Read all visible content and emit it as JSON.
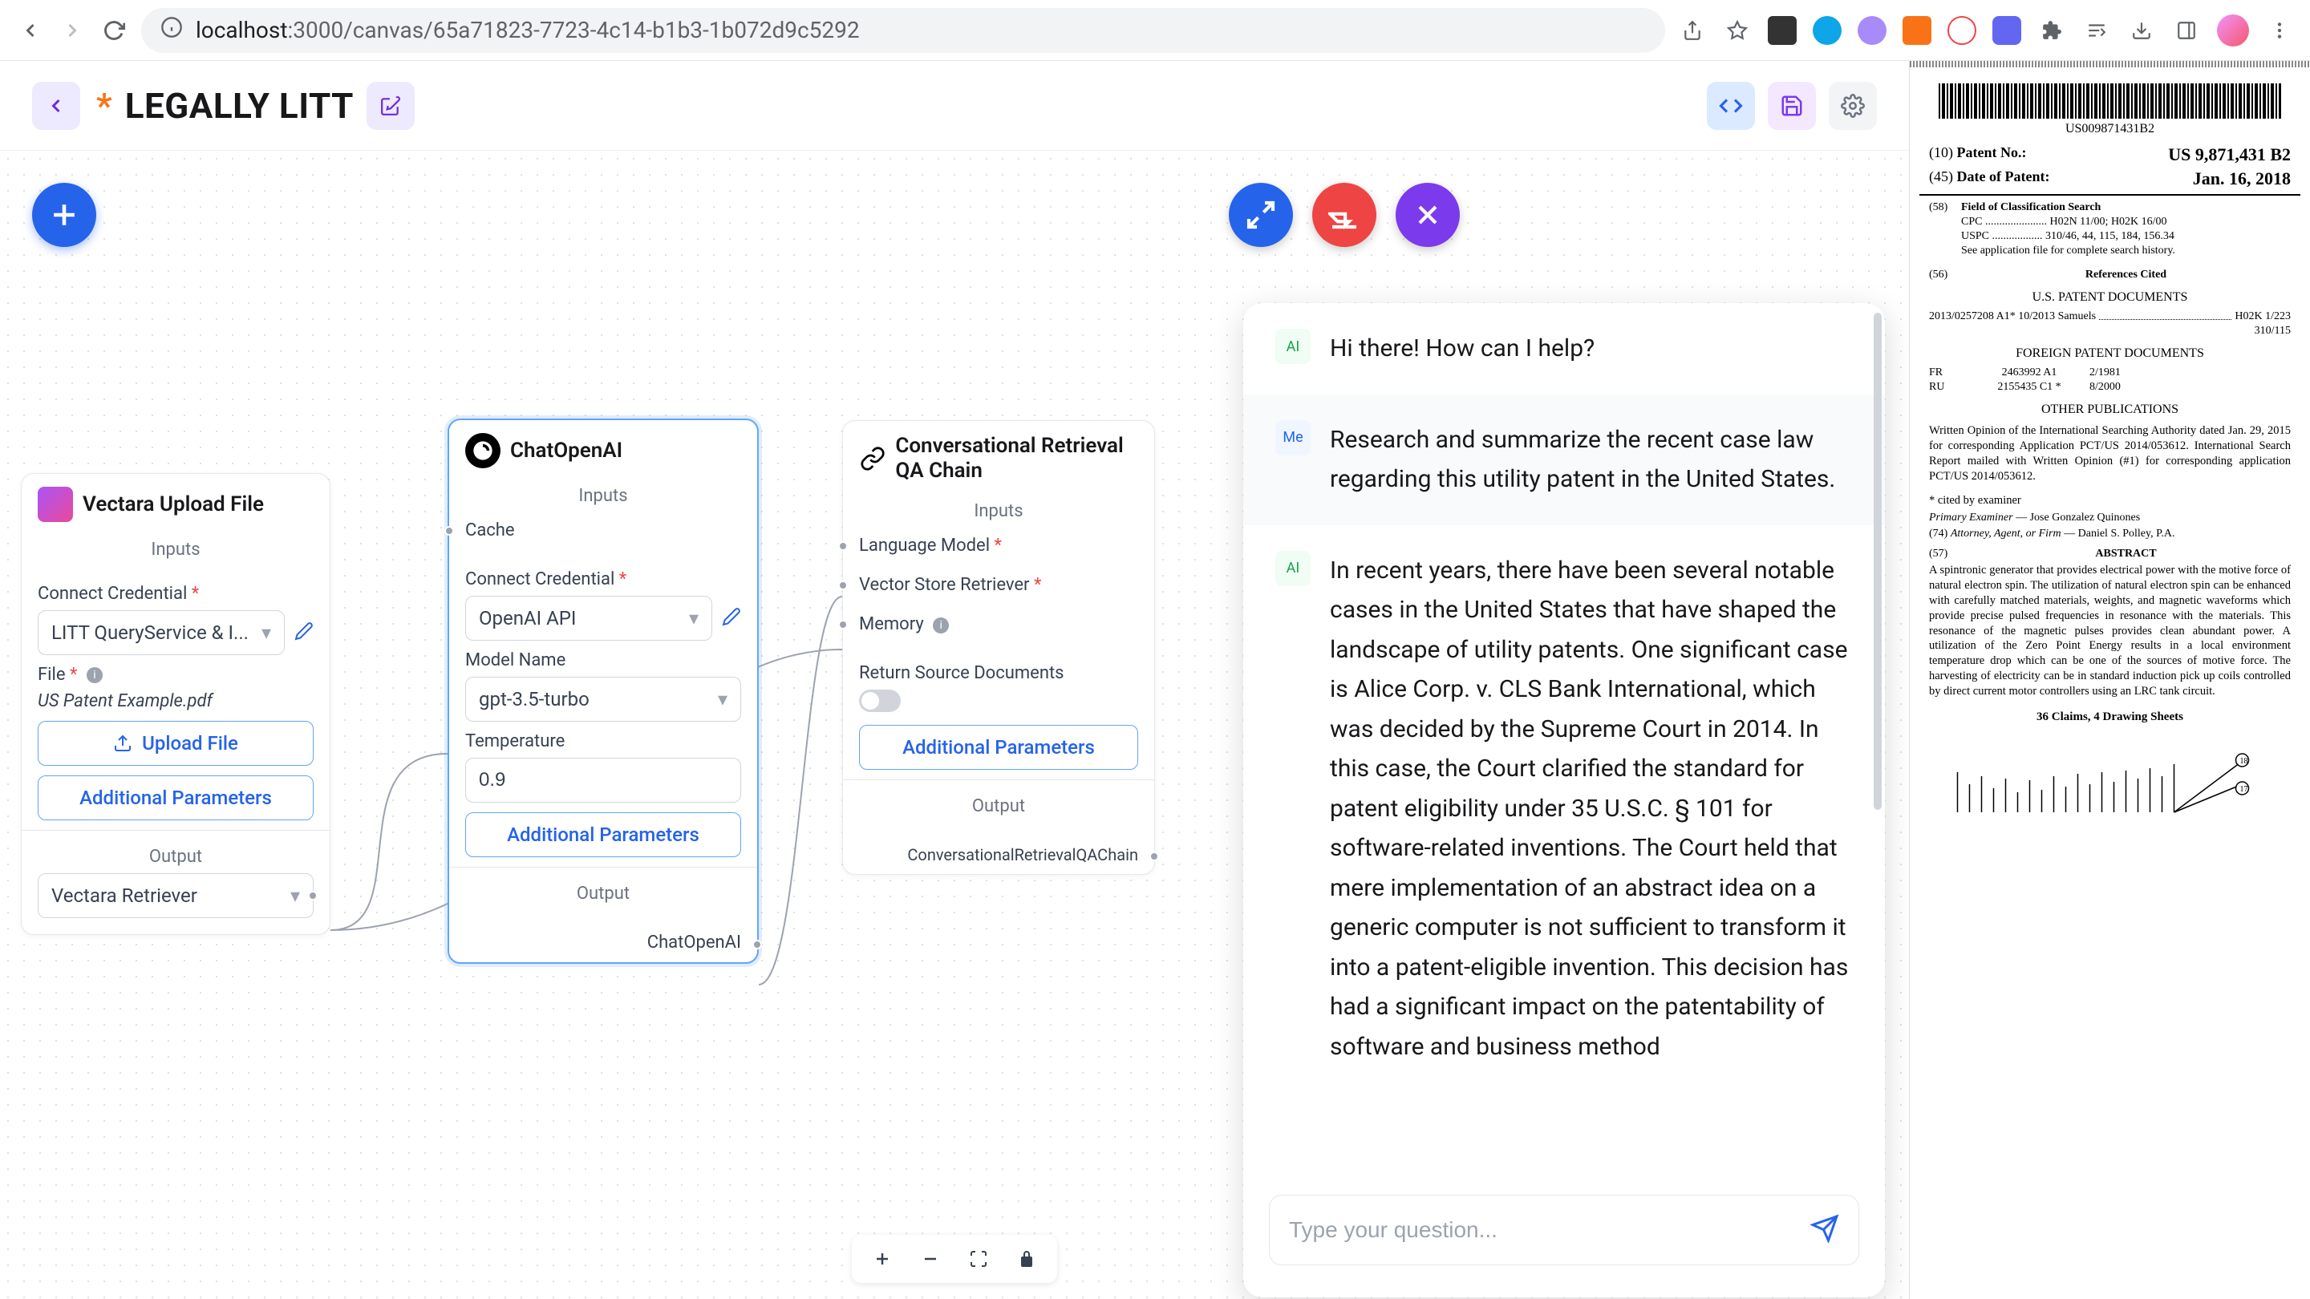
{
  "browser": {
    "url_host": "localhost",
    "url_port": ":3000",
    "url_path": "/canvas/65a71823-7723-4c14-b1b3-1b072d9c5292"
  },
  "header": {
    "asterisk": "*",
    "title": "LEGALLY LITT"
  },
  "nodes": {
    "vectara": {
      "title": "Vectara Upload File",
      "inputs_label": "Inputs",
      "connect_credential_label": "Connect Credential",
      "credential_value": "LITT QueryService & I...",
      "file_label": "File",
      "file_name": "US Patent Example.pdf",
      "upload_btn": "Upload File",
      "additional_params_btn": "Additional Parameters",
      "output_label": "Output",
      "output_select": "Vectara Retriever"
    },
    "chatopenai": {
      "title": "ChatOpenAI",
      "inputs_label": "Inputs",
      "cache_port": "Cache",
      "connect_credential_label": "Connect Credential",
      "credential_value": "OpenAI API",
      "model_name_label": "Model Name",
      "model_value": "gpt-3.5-turbo",
      "temperature_label": "Temperature",
      "temperature_value": "0.9",
      "additional_params_btn": "Additional Parameters",
      "output_label": "Output",
      "output_name": "ChatOpenAI"
    },
    "convqa": {
      "title": "Conversational Retrieval QA Chain",
      "inputs_label": "Inputs",
      "language_model_port": "Language Model",
      "vector_store_port": "Vector Store Retriever",
      "memory_port": "Memory",
      "return_source_label": "Return Source Documents",
      "additional_params_btn": "Additional Parameters",
      "output_label": "Output",
      "output_name": "ConversationalRetrievalQAChain"
    }
  },
  "chat": {
    "greeting": "Hi there! How can I help?",
    "user_query": "Research and summarize the recent case law regarding this utility patent in the United States.",
    "ai_response": "In recent years, there have been several notable cases in the United States that have shaped the landscape of utility patents. One significant case is Alice Corp. v. CLS Bank International, which was decided by the Supreme Court in 2014. In this case, the Court clarified the standard for patent eligibility under 35 U.S.C. § 101 for software-related inventions. The Court held that mere implementation of an abstract idea on a generic computer is not sufficient to transform it into a patent-eligible invention. This decision has had a significant impact on the patentability of software and business method",
    "ai_label": "AI",
    "me_label": "Me",
    "input_placeholder": "Type your question..."
  },
  "patent": {
    "barcode_text": "US009871431B2",
    "patent_no_label": "Patent No.:",
    "patent_no_prefix": "(10)",
    "patent_no": "US 9,871,431 B2",
    "date_label": "Date of Patent:",
    "date_prefix": "(45)",
    "date": "Jan. 16, 2018",
    "field_58": "(58)",
    "field_search_title": "Field of Classification Search",
    "cpc_line": "CPC ...................... H02N 11/00; H02K 16/00",
    "uspc_line": "USPC .................. 310/46, 44, 115, 184, 156.34",
    "search_history": "See application file for complete search history.",
    "field_56": "(56)",
    "refs_cited": "References Cited",
    "us_patent_docs": "U.S. PATENT DOCUMENTS",
    "us_ref_1": "2013/0257208 A1* 10/2013 Samuels",
    "us_ref_1_class": "H02K 1/223",
    "us_ref_1_sub": "310/115",
    "foreign_docs": "FOREIGN PATENT DOCUMENTS",
    "foreign_1_cc": "FR",
    "foreign_1_num": "2463992 A1",
    "foreign_1_date": "2/1981",
    "foreign_2_cc": "RU",
    "foreign_2_num": "2155435 C1 *",
    "foreign_2_date": "8/2000",
    "other_pubs": "OTHER PUBLICATIONS",
    "other_pub_text": "Written Opinion of the International Searching Authority dated Jan. 29, 2015 for corresponding Application PCT/US 2014/053612. International Search Report mailed with Written Opinion (#1) for corresponding application PCT/US 2014/053612.",
    "cited_by": "* cited by examiner",
    "primary_examiner_label": "Primary Examiner",
    "primary_examiner": " — Jose Gonzalez Quinones",
    "attorney_prefix": "(74)",
    "attorney_label": "Attorney, Agent, or Firm",
    "attorney": " — Daniel S. Polley, P.A.",
    "abstract_prefix": "(57)",
    "abstract_title": "ABSTRACT",
    "abstract_text": "A spintronic generator that provides electrical power with the motive force of natural electron spin. The utilization of natural electron spin can be enhanced with carefully matched materials, weights, and magnetic waveforms which provide precise pulsed frequencies in resonance with the materials. This resonance of the magnetic pulses provides clean abundant power. A utilization of the Zero Point Energy results in a local environment temperature drop which can be one of the sources of motive force. The harvesting of electricity can be in standard induction pick up coils controlled by direct current motor controllers using an LRC tank circuit.",
    "claims": "36 Claims, 4 Drawing Sheets"
  }
}
